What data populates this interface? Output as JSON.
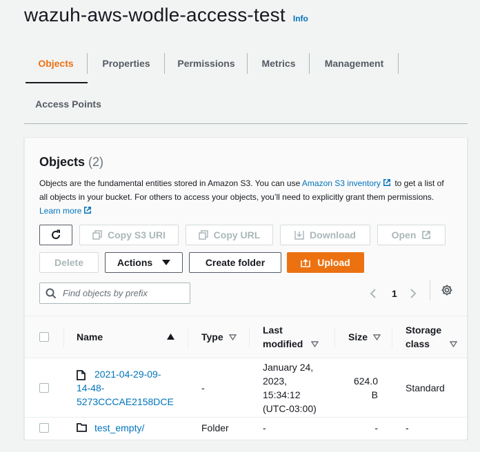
{
  "header": {
    "bucket_name": "wazuh-aws-wodle-access-test",
    "info_label": "Info"
  },
  "tabs": [
    {
      "label": "Objects",
      "active": true
    },
    {
      "label": "Properties"
    },
    {
      "label": "Permissions"
    },
    {
      "label": "Metrics"
    },
    {
      "label": "Management"
    },
    {
      "label": "Access Points"
    }
  ],
  "objects_panel": {
    "title": "Objects",
    "count": "(2)",
    "description": {
      "part1": "Objects are the fundamental entities stored in Amazon S3. You can use ",
      "inventory_link": "Amazon S3 inventory",
      "part2": " to get a list of all objects in your bucket. For others to access your objects, you’ll need to explicitly grant them permissions. ",
      "learn_more_link": "Learn more"
    },
    "buttons": {
      "copy_s3_uri": "Copy S3 URI",
      "copy_url": "Copy URL",
      "download": "Download",
      "open": "Open",
      "delete": "Delete",
      "actions": "Actions",
      "create_folder": "Create folder",
      "upload": "Upload"
    },
    "search": {
      "placeholder": "Find objects by prefix"
    },
    "pagination": {
      "current_page": "1"
    }
  },
  "table": {
    "columns": {
      "name": "Name",
      "type": "Type",
      "last_modified_1": "Last",
      "last_modified_2": "modified",
      "size": "Size",
      "storage_class_1": "Storage",
      "storage_class_2": "class"
    },
    "rows": [
      {
        "name_1": "2021-04-29-09-",
        "name_2": "14-48-",
        "name_3": "5273CCCAE2158DCE",
        "type": "-",
        "modified_1": "January 24,",
        "modified_2": "2023,",
        "modified_3": "15:34:12",
        "modified_4": "(UTC-03:00)",
        "size_1": "624.0",
        "size_2": "B",
        "storage_class": "Standard"
      },
      {
        "name": "test_empty/",
        "type": "Folder",
        "modified": "-",
        "size": "-",
        "storage_class": "-"
      }
    ]
  },
  "colors": {
    "accent_orange": "#ec7211",
    "link_blue": "#0073bb",
    "text_dark": "#16191f",
    "text_grey": "#545b64",
    "disabled": "#aab7b8"
  },
  "icons": {
    "refresh": "refresh-icon",
    "copy": "copy-icon",
    "download": "download-icon",
    "external": "external-link-icon",
    "caret": "caret-down-icon",
    "upload": "upload-icon",
    "search": "search-icon",
    "settings": "gear-icon",
    "file": "file-icon",
    "folder": "folder-icon"
  }
}
